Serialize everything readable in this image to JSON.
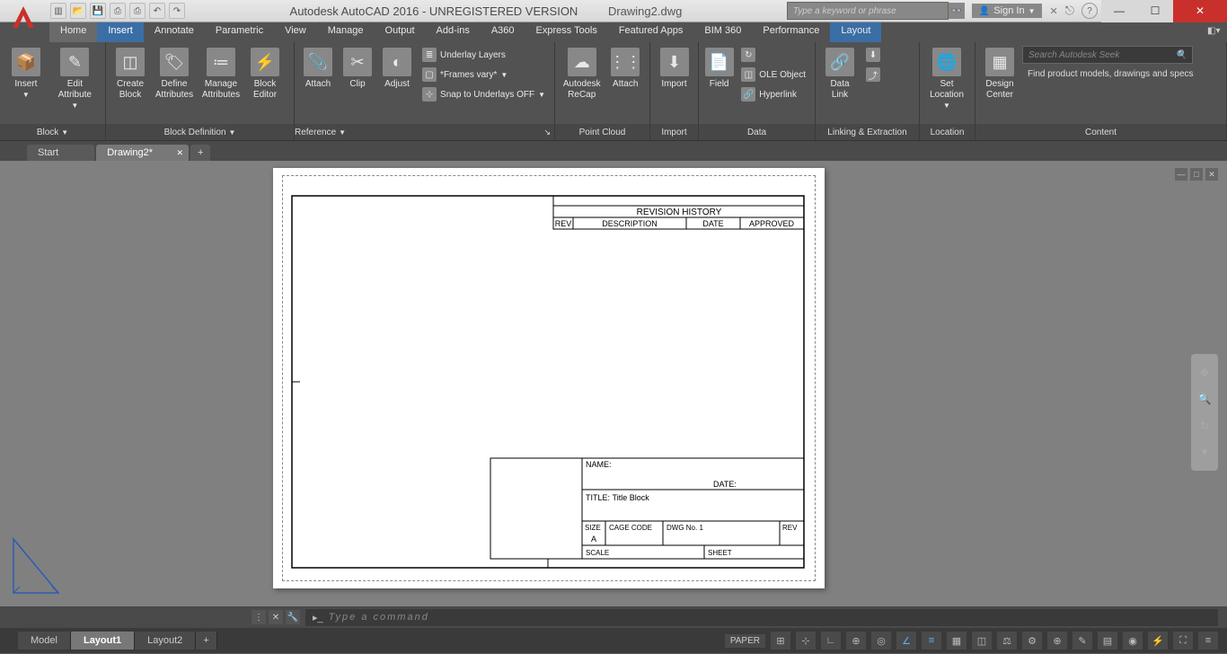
{
  "titlebar": {
    "app": "Autodesk AutoCAD 2016 - UNREGISTERED VERSION",
    "doc": "Drawing2.dwg",
    "search_placeholder": "Type a keyword or phrase",
    "signin": "Sign In"
  },
  "tabs": {
    "items": [
      "Home",
      "Insert",
      "Annotate",
      "Parametric",
      "View",
      "Manage",
      "Output",
      "Add-ins",
      "A360",
      "Express Tools",
      "Featured Apps",
      "BIM 360",
      "Performance",
      "Layout"
    ],
    "active": "Insert",
    "special": "Layout"
  },
  "ribbon": {
    "block": {
      "title": "Block",
      "insert": "Insert",
      "edit_attr": "Edit\nAttribute"
    },
    "blockdef": {
      "title": "Block Definition",
      "create": "Create\nBlock",
      "define": "Define\nAttributes",
      "manage": "Manage\nAttributes",
      "editor": "Block\nEditor"
    },
    "reference": {
      "title": "Reference",
      "attach": "Attach",
      "clip": "Clip",
      "adjust": "Adjust",
      "underlay": "Underlay Layers",
      "frames": "*Frames vary*",
      "snap": "Snap to Underlays OFF"
    },
    "pointcloud": {
      "title": "Point Cloud",
      "recap": "Autodesk\nReCap",
      "attach": "Attach"
    },
    "import": {
      "title": "Import",
      "import": "Import"
    },
    "data": {
      "title": "Data",
      "field": "Field",
      "ole": "OLE Object",
      "hyperlink": "Hyperlink"
    },
    "linking": {
      "title": "Linking & Extraction",
      "datalink": "Data\nLink"
    },
    "location": {
      "title": "Location",
      "set": "Set\nLocation"
    },
    "content": {
      "title": "Content",
      "design_center": "Design\nCenter",
      "search_placeholder": "Search Autodesk Seek",
      "desc": "Find product models, drawings and specs"
    }
  },
  "filetabs": {
    "start": "Start",
    "current": "Drawing2*"
  },
  "drawing": {
    "rev_title": "REVISION  HISTORY",
    "rev_hdr": {
      "rev": "REV",
      "desc": "DESCRIPTION",
      "date": "DATE",
      "approved": "APPROVED"
    },
    "tb": {
      "name": "NAME:",
      "date": "DATE:",
      "title_lbl": "TITLE:",
      "title_val": "Title Block",
      "size_lbl": "SIZE",
      "size_val": "A",
      "cage": "CAGE  CODE",
      "dwg_lbl": "DWG  No.",
      "dwg_val": "1",
      "rev": "REV",
      "scale": "SCALE",
      "sheet": "SHEET"
    }
  },
  "cmd": {
    "placeholder": "Type a command"
  },
  "bottom": {
    "tabs": [
      "Model",
      "Layout1",
      "Layout2"
    ],
    "active": "Layout1",
    "paper": "PAPER"
  }
}
